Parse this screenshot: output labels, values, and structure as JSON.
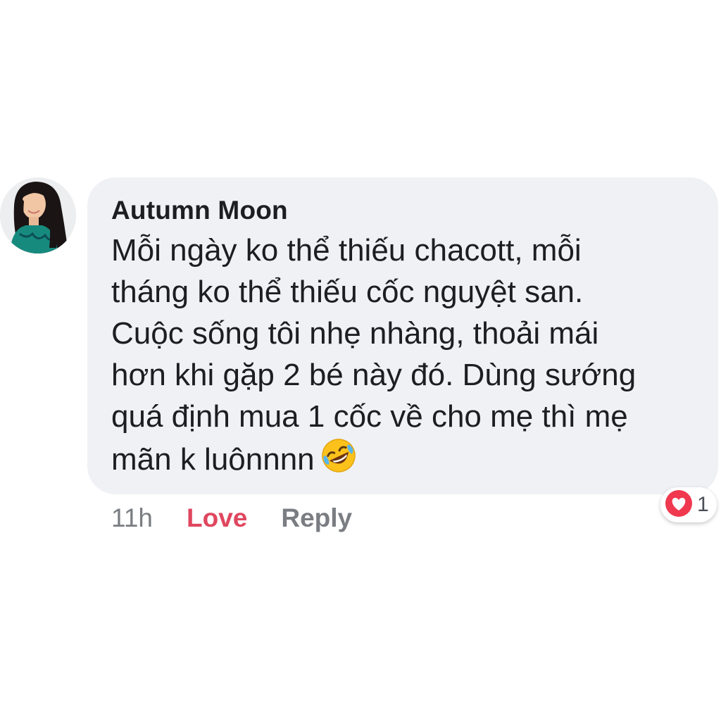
{
  "comment": {
    "author": "Autumn Moon",
    "text_lines": [
      "Mỗi ngày ko thể thiếu chacott, mỗi",
      "tháng ko thể thiếu cốc nguyệt san.",
      "Cuộc sống tôi nhẹ nhàng, thoải mái",
      "hơn khi gặp 2 bé này đó. Dùng sướng",
      "quá định mua 1 cốc về cho mẹ thì mẹ",
      "mãn k luônnnn"
    ],
    "emoji": "rolling-on-floor-laughing-emoji",
    "avatar": "avatar-photo"
  },
  "actions": {
    "time": "11h",
    "love": "Love",
    "reply": "Reply"
  },
  "reactions": {
    "icon": "heart-icon",
    "count": "1"
  },
  "colors": {
    "bubble": "#f0f1f5",
    "love": "#e0475f",
    "muted": "#7a7d82",
    "text": "#1c1e21"
  }
}
